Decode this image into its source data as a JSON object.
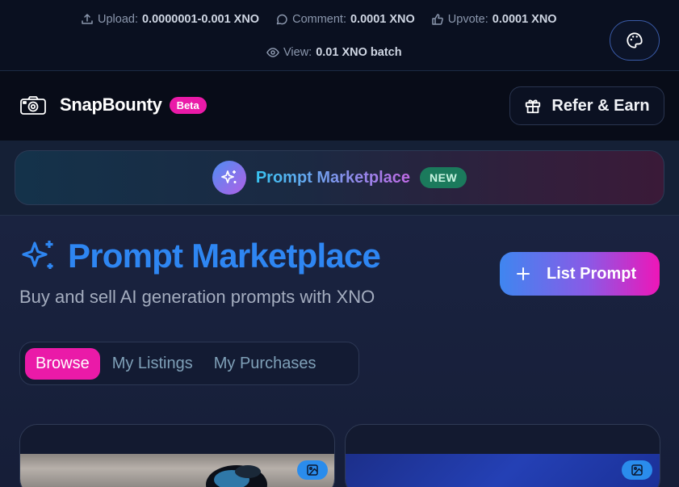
{
  "fees": {
    "upload": {
      "label": "Upload:",
      "value": "0.0000001-0.001 XNO",
      "icon": "upload-icon"
    },
    "comment": {
      "label": "Comment:",
      "value": "0.0001 XNO",
      "icon": "comment-icon"
    },
    "upvote": {
      "label": "Upvote:",
      "value": "0.0001 XNO",
      "icon": "thumbs-up-icon"
    },
    "view": {
      "label": "View:",
      "value": "0.01 XNO batch",
      "icon": "eye-icon"
    }
  },
  "header": {
    "brand": "SnapBounty",
    "beta": "Beta",
    "refer_label": "Refer & Earn"
  },
  "banner": {
    "title": "Prompt Marketplace",
    "badge": "NEW"
  },
  "page": {
    "title": "Prompt Marketplace",
    "subtitle": "Buy and sell AI generation prompts with XNO",
    "list_button": "List Prompt"
  },
  "tabs": [
    {
      "label": "Browse",
      "active": true
    },
    {
      "label": "My Listings",
      "active": false
    },
    {
      "label": "My Purchases",
      "active": false
    }
  ],
  "colors": {
    "accent_pink": "#ea1aa8",
    "accent_blue": "#2e86f2",
    "new_badge": "#1b7a5c"
  }
}
